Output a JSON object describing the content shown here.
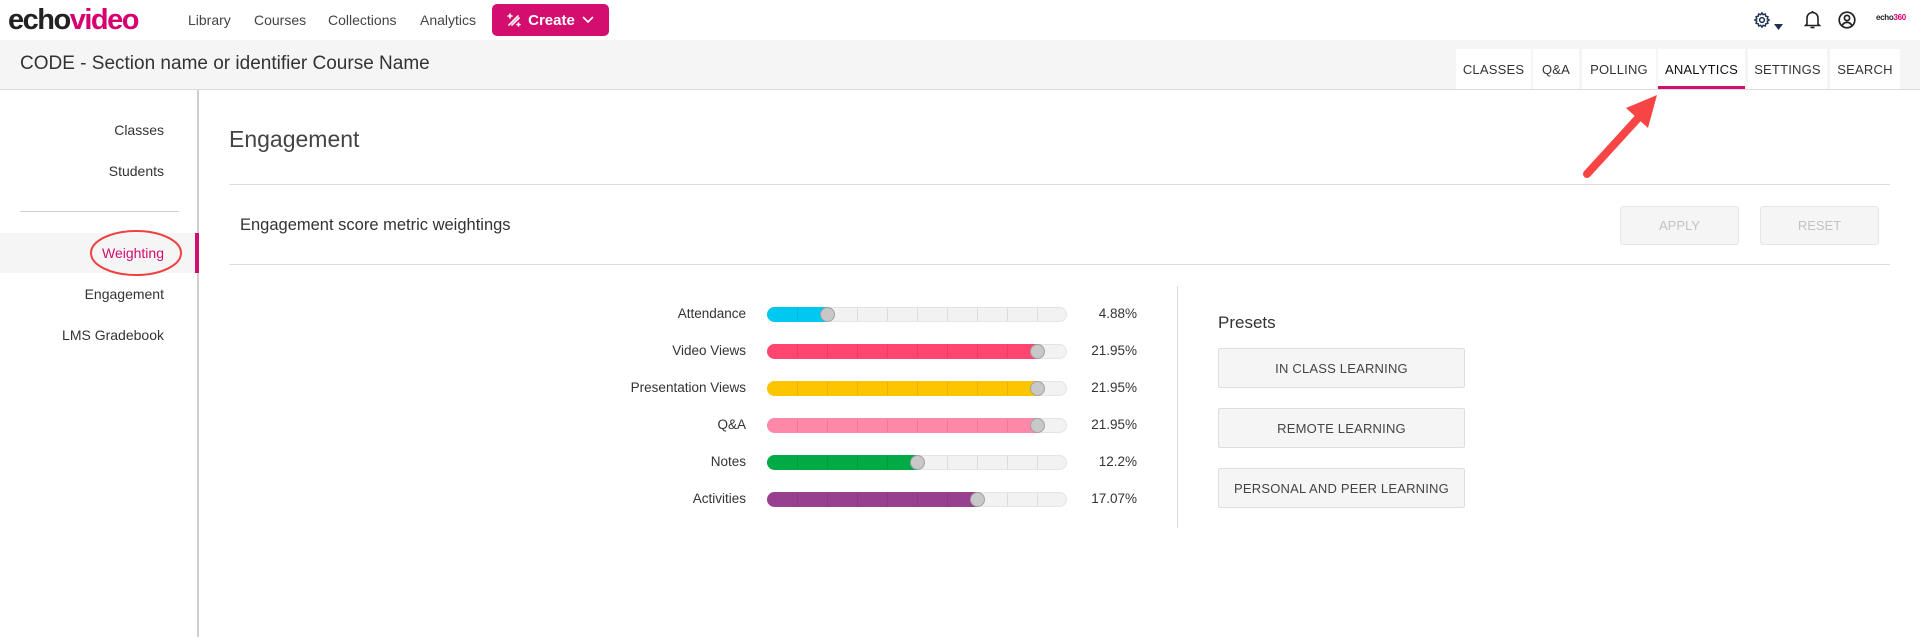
{
  "brand": {
    "logo_part1": "echo",
    "logo_part2": "video",
    "small_part1": "echo",
    "small_part2": "360"
  },
  "top_nav": {
    "links": [
      "Library",
      "Courses",
      "Collections",
      "Analytics"
    ],
    "create_label": "Create",
    "icons": [
      "wand-icon",
      "chevron-down-icon",
      "gear-icon",
      "caret-down-icon",
      "bell-icon",
      "user-account-icon"
    ]
  },
  "course": {
    "title": "CODE - Section name or identifier Course Name",
    "tabs": [
      {
        "label": "CLASSES",
        "active": false
      },
      {
        "label": "Q&A",
        "active": false
      },
      {
        "label": "POLLING",
        "active": false
      },
      {
        "label": "ANALYTICS",
        "active": true
      },
      {
        "label": "SETTINGS",
        "active": false
      },
      {
        "label": "SEARCH",
        "active": false
      }
    ]
  },
  "sidebar": {
    "group1": [
      "Classes",
      "Students"
    ],
    "group2": [
      {
        "label": "Weighting",
        "active": true
      },
      {
        "label": "Engagement",
        "active": false
      },
      {
        "label": "LMS Gradebook",
        "active": false
      }
    ]
  },
  "main": {
    "title": "Engagement",
    "section_title": "Engagement score metric weightings",
    "apply_label": "APPLY",
    "reset_label": "RESET",
    "metrics": [
      {
        "label": "Attendance",
        "value_text": "4.88%",
        "slider_level": 2,
        "slider_max": 10,
        "color": "#00c8f0"
      },
      {
        "label": "Video Views",
        "value_text": "21.95%",
        "slider_level": 9,
        "slider_max": 10,
        "color": "#ff4570"
      },
      {
        "label": "Presentation Views",
        "value_text": "21.95%",
        "slider_level": 9,
        "slider_max": 10,
        "color": "#fdc500"
      },
      {
        "label": "Q&A",
        "value_text": "21.95%",
        "slider_level": 9,
        "slider_max": 10,
        "color": "#ff88a8"
      },
      {
        "label": "Notes",
        "value_text": "12.2%",
        "slider_level": 5,
        "slider_max": 10,
        "color": "#00aa45"
      },
      {
        "label": "Activities",
        "value_text": "17.07%",
        "slider_level": 7,
        "slider_max": 10,
        "color": "#96408f"
      }
    ],
    "presets": {
      "title": "Presets",
      "buttons": [
        "IN CLASS LEARNING",
        "REMOTE LEARNING",
        "PERSONAL AND PEER LEARNING"
      ]
    }
  },
  "colors": {
    "accent": "#d30e6e",
    "annotation": "#f04040"
  }
}
